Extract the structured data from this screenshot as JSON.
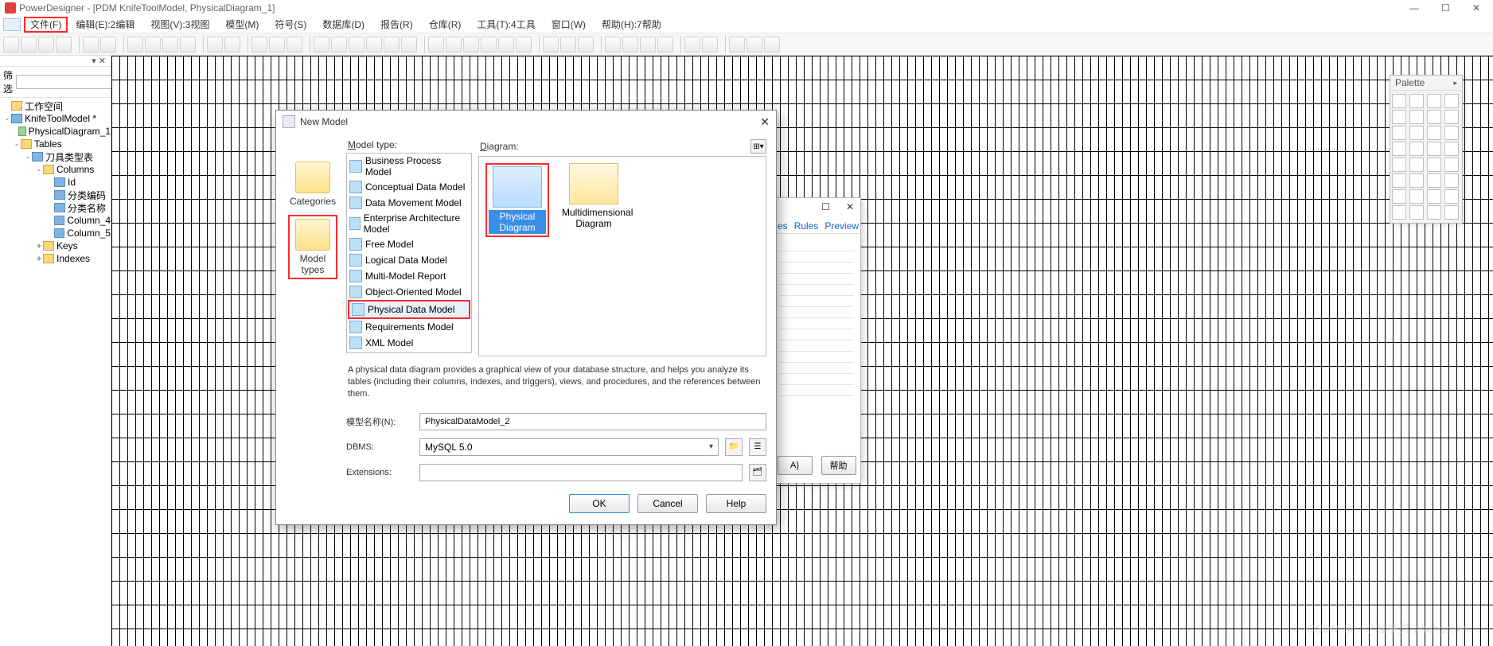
{
  "app": {
    "title": "PowerDesigner - [PDM KnifeToolModel, PhysicalDiagram_1]"
  },
  "win": {
    "minimize": "—",
    "maximize": "☐",
    "close": "✕"
  },
  "menubar": [
    "文件(F)",
    "编辑(E):2编辑",
    "视图(V):3视图",
    "模型(M)",
    "符号(S)",
    "数据库(D)",
    "报告(R)",
    "仓库(R)",
    "工具(T):4工具",
    "窗口(W)",
    "帮助(H):7帮助"
  ],
  "leftpanel": {
    "filter_label": "筛选",
    "filter_value": "",
    "tree": [
      {
        "lvl": 0,
        "exp": "",
        "ico": "folder",
        "label": "工作空间"
      },
      {
        "lvl": 0,
        "exp": "-",
        "ico": "model",
        "label": "KnifeToolModel *"
      },
      {
        "lvl": 1,
        "exp": "",
        "ico": "diagram",
        "label": "PhysicalDiagram_1"
      },
      {
        "lvl": 1,
        "exp": "-",
        "ico": "folder",
        "label": "Tables"
      },
      {
        "lvl": 2,
        "exp": "-",
        "ico": "col",
        "label": "刀具类型表"
      },
      {
        "lvl": 3,
        "exp": "-",
        "ico": "folder",
        "label": "Columns"
      },
      {
        "lvl": 4,
        "exp": "",
        "ico": "col",
        "label": "Id"
      },
      {
        "lvl": 4,
        "exp": "",
        "ico": "col",
        "label": "分类编码"
      },
      {
        "lvl": 4,
        "exp": "",
        "ico": "col",
        "label": "分类名称"
      },
      {
        "lvl": 4,
        "exp": "",
        "ico": "col",
        "label": "Column_4"
      },
      {
        "lvl": 4,
        "exp": "",
        "ico": "col",
        "label": "Column_5"
      },
      {
        "lvl": 3,
        "exp": "+",
        "ico": "folder",
        "label": "Keys"
      },
      {
        "lvl": 3,
        "exp": "+",
        "ico": "folder",
        "label": "Indexes"
      }
    ]
  },
  "palette": {
    "title": "Palette"
  },
  "backdlg": {
    "tabs": [
      "es",
      "Rules",
      "Preview"
    ],
    "btn1": "A)",
    "btn2": "帮助"
  },
  "dialog": {
    "title": "New Model",
    "label_modeltype": "Model type:",
    "label_diagram": "Diagram:",
    "categories": [
      {
        "label": "Categories",
        "hl": false
      },
      {
        "label": "Model types",
        "hl": true
      }
    ],
    "models": [
      "Business Process Model",
      "Conceptual Data Model",
      "Data Movement Model",
      "Enterprise Architecture Model",
      "Free Model",
      "Logical Data Model",
      "Multi-Model Report",
      "Object-Oriented Model",
      "Physical Data Model",
      "Requirements Model",
      "XML Model"
    ],
    "model_selected": "Physical Data Model",
    "diagrams": [
      {
        "label": "Physical Diagram",
        "sel": true
      },
      {
        "label": "Multidimensional Diagram",
        "sel": false
      }
    ],
    "desc": "A physical data diagram provides a graphical view of your database structure, and helps you analyze its tables (including their columns, indexes, and triggers), views, and procedures, and the references between them.",
    "field_modelname_label": "模型名称(N):",
    "field_modelname_value": "PhysicalDataModel_2",
    "field_dbms_label": "DBMS:",
    "field_dbms_value": "MySQL 5.0",
    "field_ext_label": "Extensions:",
    "field_ext_value": "",
    "btn_ok": "OK",
    "btn_cancel": "Cancel",
    "btn_help": "Help"
  },
  "watermark": "CSDN @一个程序员_zhangzhen"
}
